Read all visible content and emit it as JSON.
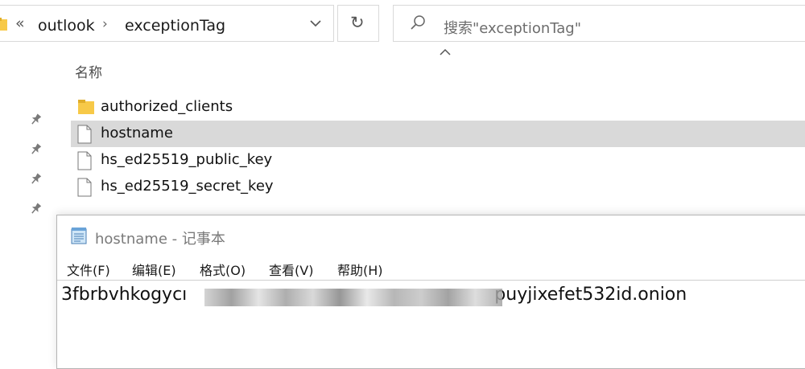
{
  "address_bar": {
    "overflow_symbol": "«",
    "crumbs": [
      "outlook",
      "exceptionTag"
    ]
  },
  "search": {
    "placeholder": "搜索\"exceptionTag\""
  },
  "file_list": {
    "column_name": "名称",
    "items": [
      {
        "name": "authorized_clients",
        "type": "folder",
        "icon": "folder-icon"
      },
      {
        "name": "hostname",
        "type": "file",
        "icon": "file-icon",
        "selected": true
      },
      {
        "name": "hs_ed25519_public_key",
        "type": "file",
        "icon": "file-icon"
      },
      {
        "name": "hs_ed25519_secret_key",
        "type": "file",
        "icon": "file-icon"
      }
    ]
  },
  "notepad": {
    "title": "hostname - 记事本",
    "menus": [
      "文件(F)",
      "编辑(E)",
      "格式(O)",
      "查看(V)",
      "帮助(H)"
    ],
    "content_visible_start": "3fbrbvhkogycı",
    "content_visible_end": "puyjixefet532id.onion"
  },
  "colors": {
    "selected_row": "#d9d9d9",
    "folder_yellow": "#f7c948",
    "border": "#d9d9d9"
  }
}
